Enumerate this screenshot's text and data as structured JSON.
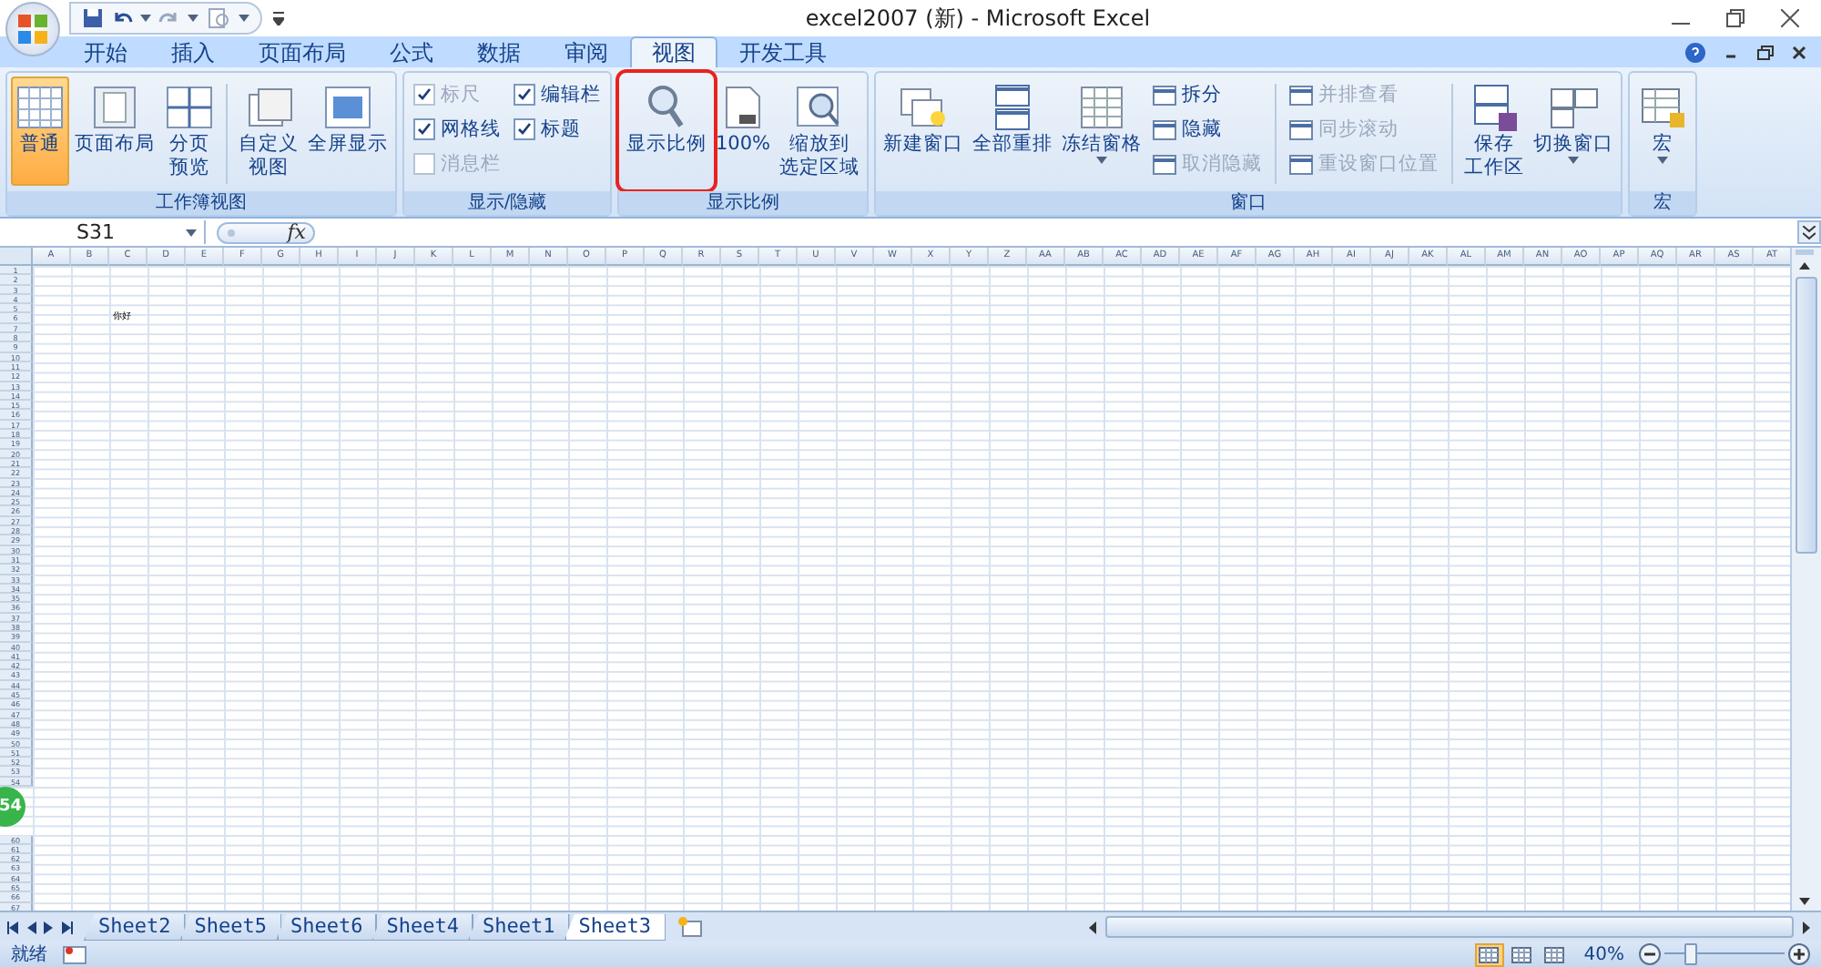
{
  "window": {
    "title": "excel2007 (新) - Microsoft Excel"
  },
  "tabs": [
    {
      "label": "开始",
      "selected": false
    },
    {
      "label": "插入",
      "selected": false
    },
    {
      "label": "页面布局",
      "selected": false
    },
    {
      "label": "公式",
      "selected": false
    },
    {
      "label": "数据",
      "selected": false
    },
    {
      "label": "审阅",
      "selected": false
    },
    {
      "label": "视图",
      "selected": true
    },
    {
      "label": "开发工具",
      "selected": false
    }
  ],
  "ribbon": {
    "groups": [
      {
        "label": "工作簿视图",
        "items": [
          {
            "kind": "large",
            "label": "普通",
            "selected": true
          },
          {
            "kind": "large",
            "label": "页面布局",
            "selected": false
          },
          {
            "kind": "large",
            "lines": [
              "分页",
              "预览"
            ],
            "selected": false
          },
          {
            "kind": "separator"
          },
          {
            "kind": "large",
            "lines": [
              "自定义",
              "视图"
            ],
            "selected": false
          },
          {
            "kind": "large",
            "label": "全屏显示",
            "selected": false
          }
        ]
      },
      {
        "label": "显示/隐藏",
        "items": [
          {
            "kind": "column",
            "items": [
              {
                "kind": "check",
                "label": "标尺",
                "checked": true,
                "disabled": true
              },
              {
                "kind": "check",
                "label": "网格线",
                "checked": true,
                "disabled": false
              },
              {
                "kind": "check",
                "label": "消息栏",
                "checked": false,
                "disabled": true
              }
            ]
          },
          {
            "kind": "column",
            "items": [
              {
                "kind": "check",
                "label": "编辑栏",
                "checked": true,
                "disabled": false
              },
              {
                "kind": "check",
                "label": "标题",
                "checked": true,
                "disabled": false
              }
            ]
          }
        ]
      },
      {
        "label": "显示比例",
        "items": [
          {
            "kind": "large",
            "label": "显示比例",
            "selected": false,
            "highlighted": true
          },
          {
            "kind": "large",
            "label": "100%",
            "selected": false
          },
          {
            "kind": "large",
            "lines": [
              "缩放到",
              "选定区域"
            ],
            "selected": false
          }
        ]
      },
      {
        "label": "窗口",
        "items": [
          {
            "kind": "large",
            "label": "新建窗口",
            "selected": false
          },
          {
            "kind": "large",
            "label": "全部重排",
            "selected": false
          },
          {
            "kind": "large",
            "label": "冻结窗格",
            "selected": false,
            "dropdown": true
          },
          {
            "kind": "column",
            "items": [
              {
                "kind": "small",
                "label": "拆分",
                "disabled": false
              },
              {
                "kind": "small",
                "label": "隐藏",
                "disabled": false
              },
              {
                "kind": "small",
                "label": "取消隐藏",
                "disabled": true
              }
            ]
          },
          {
            "kind": "separator"
          },
          {
            "kind": "column",
            "items": [
              {
                "kind": "small",
                "label": "并排查看",
                "disabled": true
              },
              {
                "kind": "small",
                "label": "同步滚动",
                "disabled": true
              },
              {
                "kind": "small",
                "label": "重设窗口位置",
                "disabled": true
              }
            ]
          },
          {
            "kind": "separator"
          },
          {
            "kind": "large",
            "lines": [
              "保存",
              "工作区"
            ],
            "selected": false
          },
          {
            "kind": "large",
            "label": "切换窗口",
            "selected": false,
            "dropdown": true
          }
        ]
      },
      {
        "label": "宏",
        "items": [
          {
            "kind": "large",
            "label": "宏",
            "selected": false,
            "dropdown": true
          }
        ]
      }
    ]
  },
  "formula_bar": {
    "name_box": "S31",
    "fx_label": "fx"
  },
  "grid": {
    "columns": [
      "A",
      "B",
      "C",
      "D",
      "E",
      "F",
      "G",
      "H",
      "I",
      "J",
      "K",
      "L",
      "M",
      "N",
      "O",
      "P",
      "Q",
      "R",
      "S",
      "T",
      "U",
      "V",
      "W",
      "X",
      "Y",
      "Z",
      "AA",
      "AB",
      "AC",
      "AD",
      "AE",
      "AF",
      "AG",
      "AH",
      "AI",
      "AJ",
      "AK",
      "AL",
      "AM",
      "AN",
      "AO",
      "AP",
      "AQ",
      "AR",
      "AS",
      "AT"
    ],
    "rows": [
      {
        "number": "1"
      },
      {
        "number": "2"
      },
      {
        "number": "3"
      },
      {
        "number": "4"
      },
      {
        "number": "5"
      },
      {
        "number": "6",
        "cells": [
          null,
          null,
          "你好"
        ]
      },
      {
        "number": "7"
      },
      {
        "number": "8"
      },
      {
        "number": "9"
      },
      {
        "number": "10"
      },
      {
        "number": "11"
      },
      {
        "number": "12"
      },
      {
        "number": "13"
      },
      {
        "number": "14"
      },
      {
        "number": "15"
      },
      {
        "number": "16"
      },
      {
        "number": "17"
      },
      {
        "number": "18"
      },
      {
        "number": "19"
      },
      {
        "number": "20"
      },
      {
        "number": "21"
      },
      {
        "number": "22"
      },
      {
        "number": "23"
      },
      {
        "number": "24"
      },
      {
        "number": "25"
      },
      {
        "number": "26"
      },
      {
        "number": "27"
      },
      {
        "number": "28"
      },
      {
        "number": "29"
      },
      {
        "number": "30"
      },
      {
        "number": "31"
      },
      {
        "number": "32"
      },
      {
        "number": "33"
      },
      {
        "number": "34"
      },
      {
        "number": "35"
      },
      {
        "number": "36"
      },
      {
        "number": "37"
      },
      {
        "number": "38"
      },
      {
        "number": "39"
      },
      {
        "number": "40"
      },
      {
        "number": "41"
      },
      {
        "number": "42"
      },
      {
        "number": "43"
      },
      {
        "number": "44"
      },
      {
        "number": "45"
      },
      {
        "number": "46"
      },
      {
        "number": "47"
      },
      {
        "number": "48"
      },
      {
        "number": "49"
      },
      {
        "number": "50"
      },
      {
        "number": "51"
      },
      {
        "number": "52"
      },
      {
        "number": "53"
      },
      {
        "number": "54"
      },
      {},
      {},
      {},
      {},
      {},
      {
        "number": "60"
      },
      {
        "number": "61"
      },
      {
        "number": "62"
      },
      {
        "number": "63"
      },
      {
        "number": "64"
      },
      {
        "number": "65"
      },
      {
        "number": "66"
      },
      {
        "number": "67"
      }
    ]
  },
  "sheet_tabs": [
    {
      "label": "Sheet2",
      "selected": false
    },
    {
      "label": "Sheet5",
      "selected": false
    },
    {
      "label": "Sheet6",
      "selected": false
    },
    {
      "label": "Sheet4",
      "selected": false
    },
    {
      "label": "Sheet1",
      "selected": false
    },
    {
      "label": "Sheet3",
      "selected": true
    }
  ],
  "status_bar": {
    "status": "就绪",
    "views": [
      {
        "selected": true
      },
      {
        "selected": false
      },
      {
        "selected": false
      }
    ],
    "zoom": "40%",
    "zoom_level": {
      "level": 0.2
    }
  },
  "side_badge": {
    "text": "54"
  }
}
